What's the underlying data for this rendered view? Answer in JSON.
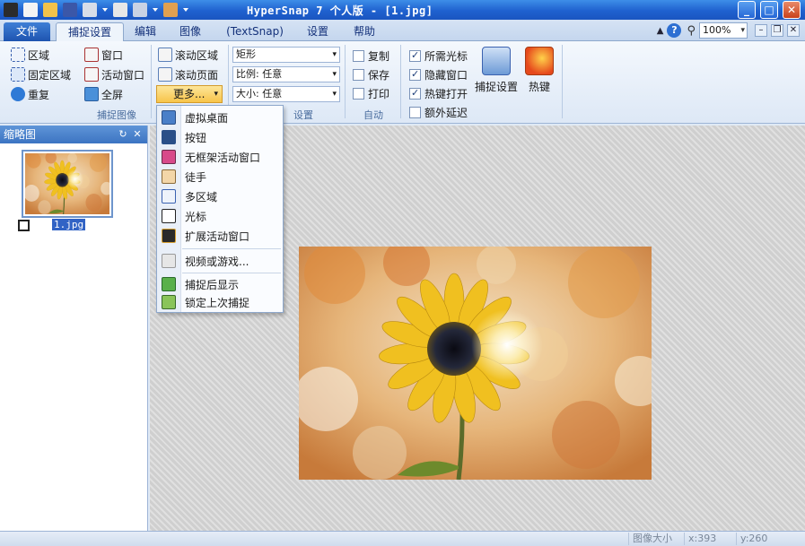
{
  "window": {
    "title": "HyperSnap 7 个人版 - [1.jpg]",
    "minimize": "_",
    "maximize": "□",
    "close": "✕"
  },
  "tabs": [
    "文件",
    "捕捉设置",
    "编辑",
    "图像",
    "(TextSnap)",
    "设置",
    "帮助"
  ],
  "toolbar_right": {
    "zoom": "100%"
  },
  "ribbon": {
    "capture_group": {
      "label": "捕捉图像",
      "items": [
        "区域",
        "固定区域",
        "重复",
        "窗口",
        "活动窗口",
        "全屏",
        "滚动区域",
        "滚动页面"
      ],
      "more": "更多..."
    },
    "options_group": {
      "label": "设置",
      "shape": "矩形",
      "ratio": "比例: 任意",
      "size": "大小: 任意"
    },
    "auto_group": {
      "label": "自动",
      "items": [
        "复制",
        "保存",
        "打印"
      ]
    },
    "checks": [
      {
        "label": "所需光标",
        "checked": true
      },
      {
        "label": "隐藏窗口",
        "checked": true
      },
      {
        "label": "热键打开",
        "checked": true
      },
      {
        "label": "额外延迟",
        "checked": false
      }
    ],
    "buttons": [
      "捕捉设置",
      "热键"
    ]
  },
  "dropdown": {
    "items": [
      "虚拟桌面",
      "按钮",
      "无框架活动窗口",
      "徒手",
      "多区域",
      "光标",
      "扩展活动窗口"
    ],
    "items2": [
      "视频或游戏..."
    ],
    "items3": [
      "捕捉后显示",
      "锁定上次捕捉"
    ]
  },
  "thumbnails": {
    "title": "缩略图",
    "file": "1.jpg"
  },
  "status": {
    "size_label": "图像大小",
    "x": "x:393",
    "y": "y:260"
  },
  "colors": {
    "titlebar": "#1f61cf",
    "accent": "#f7c44a",
    "ribbon": "#dde8f6"
  }
}
